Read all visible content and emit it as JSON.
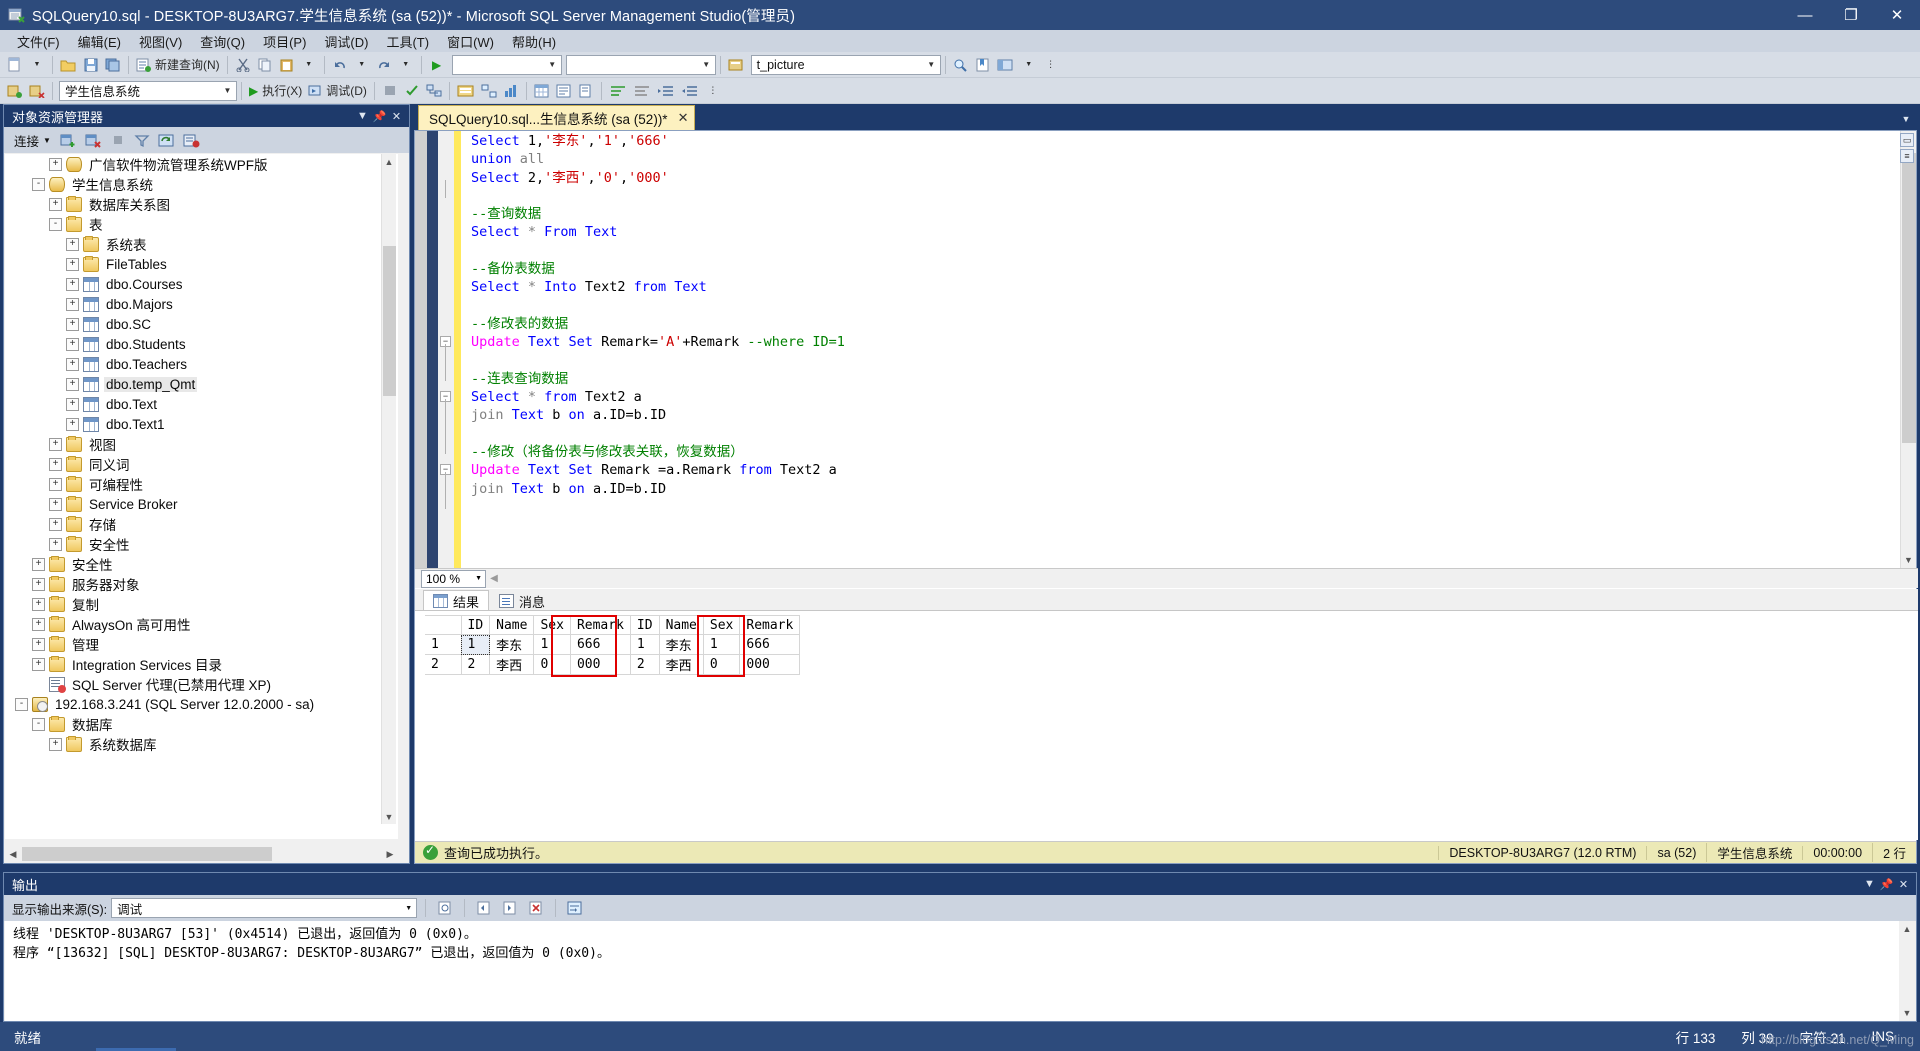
{
  "window": {
    "title": "SQLQuery10.sql - DESKTOP-8U3ARG7.学生信息系统 (sa (52))* - Microsoft SQL Server Management Studio(管理员)",
    "minimize": "—",
    "maximize": "❐",
    "close": "✕"
  },
  "menubar": {
    "items": [
      {
        "label": "文件(F)"
      },
      {
        "label": "编辑(E)"
      },
      {
        "label": "视图(V)"
      },
      {
        "label": "查询(Q)"
      },
      {
        "label": "项目(P)"
      },
      {
        "label": "调试(D)"
      },
      {
        "label": "工具(T)"
      },
      {
        "label": "窗口(W)"
      },
      {
        "label": "帮助(H)"
      }
    ]
  },
  "toolbar1": {
    "new_query_label": "新建查询(N)",
    "combo_left_placeholder": "",
    "combo_mid_placeholder": "",
    "combo_right_value": "t_picture"
  },
  "toolbar2": {
    "db_combo_value": "学生信息系统",
    "execute_label": "执行(X)",
    "debug_label": "调试(D)"
  },
  "object_explorer": {
    "title": "对象资源管理器",
    "connect_label": "连接",
    "tree": [
      {
        "indent": 2,
        "expander": "+",
        "icon": "db",
        "label": "广信软件物流管理系统WPF版",
        "selected": false
      },
      {
        "indent": 1,
        "expander": "-",
        "icon": "db",
        "label": "学生信息系统",
        "selected": false
      },
      {
        "indent": 2,
        "expander": "+",
        "icon": "folder",
        "label": "数据库关系图",
        "selected": false
      },
      {
        "indent": 2,
        "expander": "-",
        "icon": "folder",
        "label": "表",
        "selected": false
      },
      {
        "indent": 3,
        "expander": "+",
        "icon": "folder",
        "label": "系统表",
        "selected": false
      },
      {
        "indent": 3,
        "expander": "+",
        "icon": "folder",
        "label": "FileTables",
        "selected": false
      },
      {
        "indent": 3,
        "expander": "+",
        "icon": "table",
        "label": "dbo.Courses",
        "selected": false
      },
      {
        "indent": 3,
        "expander": "+",
        "icon": "table",
        "label": "dbo.Majors",
        "selected": false
      },
      {
        "indent": 3,
        "expander": "+",
        "icon": "table",
        "label": "dbo.SC",
        "selected": false
      },
      {
        "indent": 3,
        "expander": "+",
        "icon": "table",
        "label": "dbo.Students",
        "selected": false
      },
      {
        "indent": 3,
        "expander": "+",
        "icon": "table",
        "label": "dbo.Teachers",
        "selected": false
      },
      {
        "indent": 3,
        "expander": "+",
        "icon": "table",
        "label": "dbo.temp_Qmt",
        "selected": true
      },
      {
        "indent": 3,
        "expander": "+",
        "icon": "table",
        "label": "dbo.Text",
        "selected": false
      },
      {
        "indent": 3,
        "expander": "+",
        "icon": "table",
        "label": "dbo.Text1",
        "selected": false
      },
      {
        "indent": 2,
        "expander": "+",
        "icon": "folder",
        "label": "视图",
        "selected": false
      },
      {
        "indent": 2,
        "expander": "+",
        "icon": "folder",
        "label": "同义词",
        "selected": false
      },
      {
        "indent": 2,
        "expander": "+",
        "icon": "folder",
        "label": "可编程性",
        "selected": false
      },
      {
        "indent": 2,
        "expander": "+",
        "icon": "folder",
        "label": "Service Broker",
        "selected": false
      },
      {
        "indent": 2,
        "expander": "+",
        "icon": "folder",
        "label": "存储",
        "selected": false
      },
      {
        "indent": 2,
        "expander": "+",
        "icon": "folder",
        "label": "安全性",
        "selected": false
      },
      {
        "indent": 1,
        "expander": "+",
        "icon": "folder",
        "label": "安全性",
        "selected": false
      },
      {
        "indent": 1,
        "expander": "+",
        "icon": "folder",
        "label": "服务器对象",
        "selected": false
      },
      {
        "indent": 1,
        "expander": "+",
        "icon": "folder",
        "label": "复制",
        "selected": false
      },
      {
        "indent": 1,
        "expander": "+",
        "icon": "folder",
        "label": "AlwaysOn 高可用性",
        "selected": false
      },
      {
        "indent": 1,
        "expander": "+",
        "icon": "folder",
        "label": "管理",
        "selected": false
      },
      {
        "indent": 1,
        "expander": "+",
        "icon": "folder",
        "label": "Integration Services 目录",
        "selected": false
      },
      {
        "indent": 1,
        "expander": "",
        "icon": "agent",
        "label": "SQL Server 代理(已禁用代理 XP)",
        "selected": false
      },
      {
        "indent": 0,
        "expander": "-",
        "icon": "server",
        "label": "192.168.3.241 (SQL Server 12.0.2000 - sa)",
        "selected": false
      },
      {
        "indent": 1,
        "expander": "-",
        "icon": "folder",
        "label": "数据库",
        "selected": false
      },
      {
        "indent": 2,
        "expander": "+",
        "icon": "folder",
        "label": "系统数据库",
        "selected": false
      }
    ]
  },
  "editor": {
    "tab_label": "SQLQuery10.sql...生信息系统 (sa (52))*",
    "tab_close": "✕",
    "zoom": "100 %",
    "code_lines": [
      [
        {
          "t": "kw",
          "s": "Select"
        },
        {
          "t": "pl",
          "s": " 1,"
        },
        {
          "t": "str",
          "s": "'李东'"
        },
        {
          "t": "pl",
          "s": ","
        },
        {
          "t": "str",
          "s": "'1'"
        },
        {
          "t": "pl",
          "s": ","
        },
        {
          "t": "str",
          "s": "'666'"
        }
      ],
      [
        {
          "t": "kw",
          "s": "union"
        },
        {
          "t": "op",
          "s": " all"
        }
      ],
      [
        {
          "t": "kw",
          "s": "Select"
        },
        {
          "t": "pl",
          "s": " 2,"
        },
        {
          "t": "str",
          "s": "'李西'"
        },
        {
          "t": "pl",
          "s": ","
        },
        {
          "t": "str",
          "s": "'0'"
        },
        {
          "t": "pl",
          "s": ","
        },
        {
          "t": "str",
          "s": "'000'"
        }
      ],
      [],
      [
        {
          "t": "cmt",
          "s": "--查询数据"
        }
      ],
      [
        {
          "t": "kw",
          "s": "Select"
        },
        {
          "t": "op",
          "s": " * "
        },
        {
          "t": "kw",
          "s": "From"
        },
        {
          "t": "kw",
          "s": " Text"
        }
      ],
      [],
      [
        {
          "t": "cmt",
          "s": "--备份表数据"
        }
      ],
      [
        {
          "t": "kw",
          "s": "Select"
        },
        {
          "t": "op",
          "s": " * "
        },
        {
          "t": "kw",
          "s": "Into"
        },
        {
          "t": "pl",
          "s": " Text2 "
        },
        {
          "t": "kw",
          "s": "from Text"
        }
      ],
      [],
      [
        {
          "t": "cmt",
          "s": "--修改表的数据"
        }
      ],
      [
        {
          "t": "kwm",
          "s": "Update"
        },
        {
          "t": "kw",
          "s": " Text Set"
        },
        {
          "t": "pl",
          "s": " Remark="
        },
        {
          "t": "str",
          "s": "'A'"
        },
        {
          "t": "pl",
          "s": "+Remark "
        },
        {
          "t": "cmt",
          "s": "--where ID=1"
        }
      ],
      [],
      [
        {
          "t": "cmt",
          "s": "--连表查询数据"
        }
      ],
      [
        {
          "t": "kw",
          "s": "Select"
        },
        {
          "t": "op",
          "s": " * "
        },
        {
          "t": "kw",
          "s": "from"
        },
        {
          "t": "pl",
          "s": " Text2 a"
        }
      ],
      [
        {
          "t": "op",
          "s": "join "
        },
        {
          "t": "kw",
          "s": "Text"
        },
        {
          "t": "pl",
          "s": " b "
        },
        {
          "t": "kw",
          "s": "on"
        },
        {
          "t": "pl",
          "s": " a.ID=b.ID"
        }
      ],
      [],
      [
        {
          "t": "cmt",
          "s": "--修改（将备份表与修改表关联，恢复数据）"
        }
      ],
      [
        {
          "t": "kwm",
          "s": "Update"
        },
        {
          "t": "kw",
          "s": " Text Set"
        },
        {
          "t": "pl",
          "s": " Remark =a.Remark "
        },
        {
          "t": "kw",
          "s": "from"
        },
        {
          "t": "pl",
          "s": " Text2 a"
        }
      ],
      [
        {
          "t": "op",
          "s": "join "
        },
        {
          "t": "kw",
          "s": "Text"
        },
        {
          "t": "pl",
          "s": " b "
        },
        {
          "t": "kw",
          "s": "on"
        },
        {
          "t": "pl",
          "s": " a.ID=b.ID"
        }
      ]
    ]
  },
  "results": {
    "tabs": [
      {
        "label": "结果",
        "icon": "grid-icon",
        "active": true
      },
      {
        "label": "消息",
        "icon": "message-icon",
        "active": false
      }
    ],
    "columns": [
      "",
      "ID",
      "Name",
      "Sex",
      "Remark",
      "ID",
      "Name",
      "Sex",
      "Remark"
    ],
    "rows": [
      [
        "1",
        "1",
        "李东",
        "1",
        "666",
        "1",
        "李东",
        "1",
        "666"
      ],
      [
        "2",
        "2",
        "李西",
        "0",
        "000",
        "2",
        "李西",
        "0",
        "000"
      ]
    ],
    "highlight_color": "#e00000",
    "status_message": "查询已成功执行。",
    "status_segments": [
      "DESKTOP-8U3ARG7 (12.0 RTM)",
      "sa (52)",
      "学生信息系统",
      "00:00:00",
      "2 行"
    ]
  },
  "output": {
    "title": "输出",
    "source_label": "显示输出来源(S):",
    "source_value": "调试",
    "lines": [
      "线程 'DESKTOP-8U3ARG7 [53]' (0x4514) 已退出，返回值为 0 (0x0)。",
      "程序 “[13632] [SQL] DESKTOP-8U3ARG7: DESKTOP-8U3ARG7” 已退出，返回值为 0 (0x0)。"
    ]
  },
  "app_status": {
    "ready": "就绪",
    "line_label": "行 133",
    "col_label": "列 39",
    "char_label": "字符 21",
    "ins_label": "INS"
  },
  "watermark": "http://blog.csdn.net/Q_Ming"
}
